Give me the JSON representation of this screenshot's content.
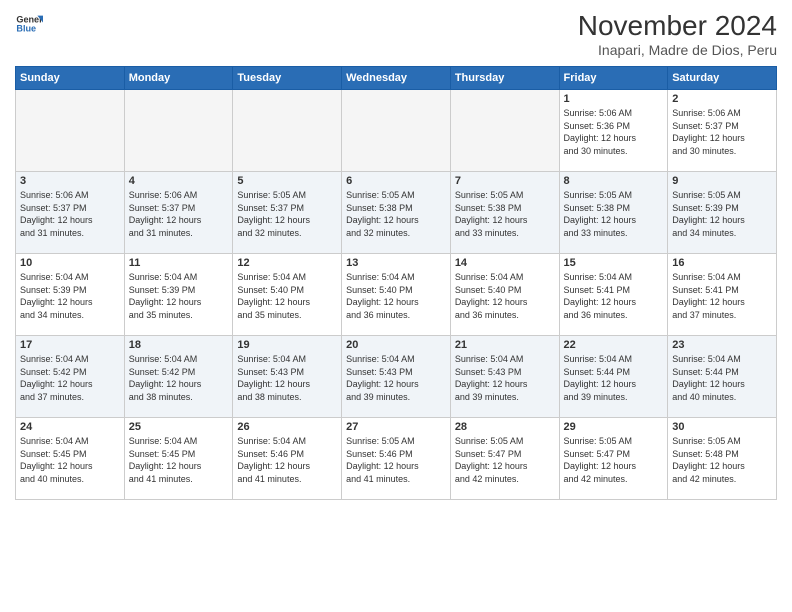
{
  "logo": {
    "line1": "General",
    "line2": "Blue"
  },
  "title": "November 2024",
  "location": "Inapari, Madre de Dios, Peru",
  "weekdays": [
    "Sunday",
    "Monday",
    "Tuesday",
    "Wednesday",
    "Thursday",
    "Friday",
    "Saturday"
  ],
  "weeks": [
    [
      {
        "day": "",
        "info": ""
      },
      {
        "day": "",
        "info": ""
      },
      {
        "day": "",
        "info": ""
      },
      {
        "day": "",
        "info": ""
      },
      {
        "day": "",
        "info": ""
      },
      {
        "day": "1",
        "info": "Sunrise: 5:06 AM\nSunset: 5:36 PM\nDaylight: 12 hours\nand 30 minutes."
      },
      {
        "day": "2",
        "info": "Sunrise: 5:06 AM\nSunset: 5:37 PM\nDaylight: 12 hours\nand 30 minutes."
      }
    ],
    [
      {
        "day": "3",
        "info": "Sunrise: 5:06 AM\nSunset: 5:37 PM\nDaylight: 12 hours\nand 31 minutes."
      },
      {
        "day": "4",
        "info": "Sunrise: 5:06 AM\nSunset: 5:37 PM\nDaylight: 12 hours\nand 31 minutes."
      },
      {
        "day": "5",
        "info": "Sunrise: 5:05 AM\nSunset: 5:37 PM\nDaylight: 12 hours\nand 32 minutes."
      },
      {
        "day": "6",
        "info": "Sunrise: 5:05 AM\nSunset: 5:38 PM\nDaylight: 12 hours\nand 32 minutes."
      },
      {
        "day": "7",
        "info": "Sunrise: 5:05 AM\nSunset: 5:38 PM\nDaylight: 12 hours\nand 33 minutes."
      },
      {
        "day": "8",
        "info": "Sunrise: 5:05 AM\nSunset: 5:38 PM\nDaylight: 12 hours\nand 33 minutes."
      },
      {
        "day": "9",
        "info": "Sunrise: 5:05 AM\nSunset: 5:39 PM\nDaylight: 12 hours\nand 34 minutes."
      }
    ],
    [
      {
        "day": "10",
        "info": "Sunrise: 5:04 AM\nSunset: 5:39 PM\nDaylight: 12 hours\nand 34 minutes."
      },
      {
        "day": "11",
        "info": "Sunrise: 5:04 AM\nSunset: 5:39 PM\nDaylight: 12 hours\nand 35 minutes."
      },
      {
        "day": "12",
        "info": "Sunrise: 5:04 AM\nSunset: 5:40 PM\nDaylight: 12 hours\nand 35 minutes."
      },
      {
        "day": "13",
        "info": "Sunrise: 5:04 AM\nSunset: 5:40 PM\nDaylight: 12 hours\nand 36 minutes."
      },
      {
        "day": "14",
        "info": "Sunrise: 5:04 AM\nSunset: 5:40 PM\nDaylight: 12 hours\nand 36 minutes."
      },
      {
        "day": "15",
        "info": "Sunrise: 5:04 AM\nSunset: 5:41 PM\nDaylight: 12 hours\nand 36 minutes."
      },
      {
        "day": "16",
        "info": "Sunrise: 5:04 AM\nSunset: 5:41 PM\nDaylight: 12 hours\nand 37 minutes."
      }
    ],
    [
      {
        "day": "17",
        "info": "Sunrise: 5:04 AM\nSunset: 5:42 PM\nDaylight: 12 hours\nand 37 minutes."
      },
      {
        "day": "18",
        "info": "Sunrise: 5:04 AM\nSunset: 5:42 PM\nDaylight: 12 hours\nand 38 minutes."
      },
      {
        "day": "19",
        "info": "Sunrise: 5:04 AM\nSunset: 5:43 PM\nDaylight: 12 hours\nand 38 minutes."
      },
      {
        "day": "20",
        "info": "Sunrise: 5:04 AM\nSunset: 5:43 PM\nDaylight: 12 hours\nand 39 minutes."
      },
      {
        "day": "21",
        "info": "Sunrise: 5:04 AM\nSunset: 5:43 PM\nDaylight: 12 hours\nand 39 minutes."
      },
      {
        "day": "22",
        "info": "Sunrise: 5:04 AM\nSunset: 5:44 PM\nDaylight: 12 hours\nand 39 minutes."
      },
      {
        "day": "23",
        "info": "Sunrise: 5:04 AM\nSunset: 5:44 PM\nDaylight: 12 hours\nand 40 minutes."
      }
    ],
    [
      {
        "day": "24",
        "info": "Sunrise: 5:04 AM\nSunset: 5:45 PM\nDaylight: 12 hours\nand 40 minutes."
      },
      {
        "day": "25",
        "info": "Sunrise: 5:04 AM\nSunset: 5:45 PM\nDaylight: 12 hours\nand 41 minutes."
      },
      {
        "day": "26",
        "info": "Sunrise: 5:04 AM\nSunset: 5:46 PM\nDaylight: 12 hours\nand 41 minutes."
      },
      {
        "day": "27",
        "info": "Sunrise: 5:05 AM\nSunset: 5:46 PM\nDaylight: 12 hours\nand 41 minutes."
      },
      {
        "day": "28",
        "info": "Sunrise: 5:05 AM\nSunset: 5:47 PM\nDaylight: 12 hours\nand 42 minutes."
      },
      {
        "day": "29",
        "info": "Sunrise: 5:05 AM\nSunset: 5:47 PM\nDaylight: 12 hours\nand 42 minutes."
      },
      {
        "day": "30",
        "info": "Sunrise: 5:05 AM\nSunset: 5:48 PM\nDaylight: 12 hours\nand 42 minutes."
      }
    ]
  ]
}
